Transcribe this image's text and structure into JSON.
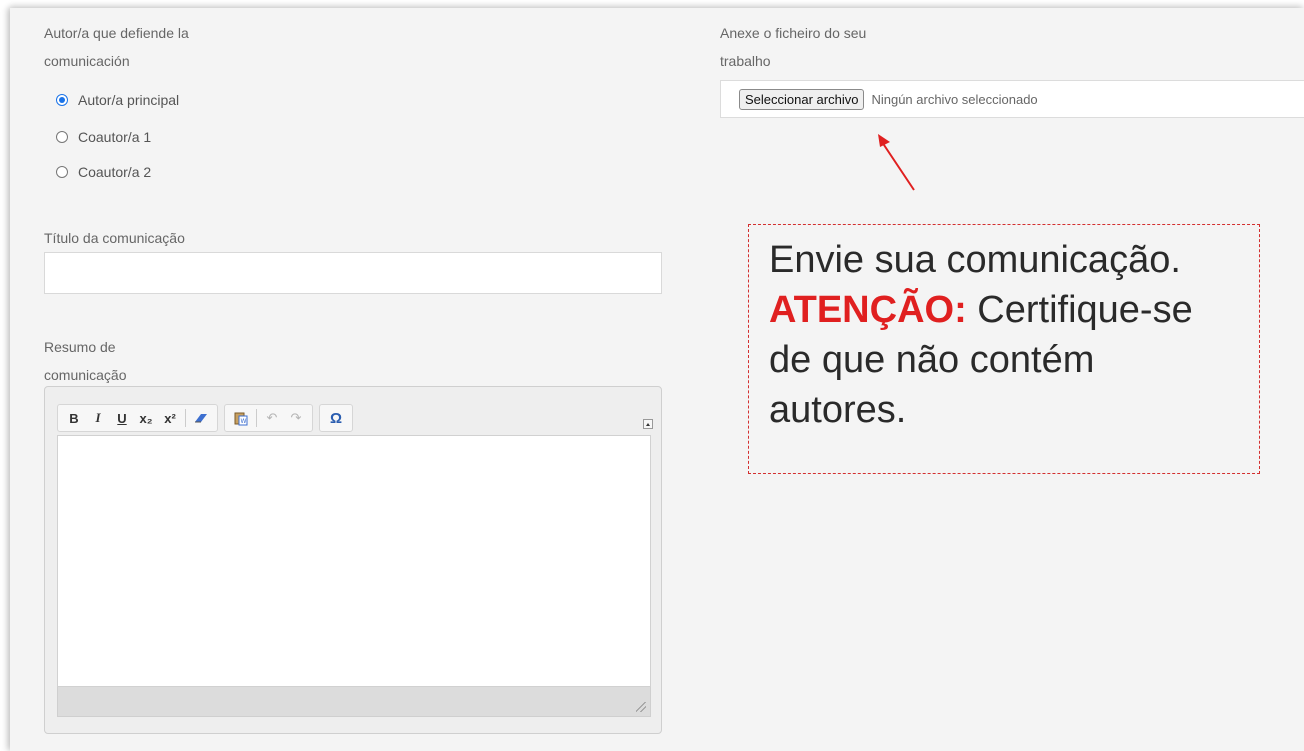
{
  "author_section": {
    "label_line1": "Autor/a que defiende la",
    "label_line2": "comunicación",
    "options": [
      {
        "label": "Autor/a principal",
        "checked": true
      },
      {
        "label": "Coautor/a 1",
        "checked": false
      },
      {
        "label": "Coautor/a 2",
        "checked": false
      }
    ]
  },
  "title_field": {
    "label": "Título da comunicação",
    "value": ""
  },
  "abstract": {
    "label_line1": "Resumo de",
    "label_line2": "comunicação",
    "toolbar": {
      "bold": "B",
      "italic": "I",
      "underline": "U",
      "subscript": "x₂",
      "superscript": "x²",
      "undo": "↶",
      "redo": "↷",
      "special_char": "Ω"
    },
    "icons": [
      "bold-icon",
      "italic-icon",
      "underline-icon",
      "subscript-icon",
      "superscript-icon",
      "eraser-icon",
      "paste-word-icon",
      "undo-icon",
      "redo-icon",
      "omega-icon"
    ],
    "value": ""
  },
  "attachment": {
    "label_line1": "Anexe o ficheiro do seu",
    "label_line2": "trabalho",
    "button_label": "Seleccionar archivo",
    "status": "Ningún archivo seleccionado"
  },
  "callout": {
    "text_part1": "Envie sua comunicação.",
    "attention": "ATENÇÃO:",
    "text_part2": "Certifique-se de que não contém autores.",
    "border_color": "#d32f2f",
    "attention_color": "#e02020"
  },
  "colors": {
    "panel_bg": "#f4f4f4",
    "radio_accent": "#1a73e8",
    "arrow": "#e02020"
  }
}
